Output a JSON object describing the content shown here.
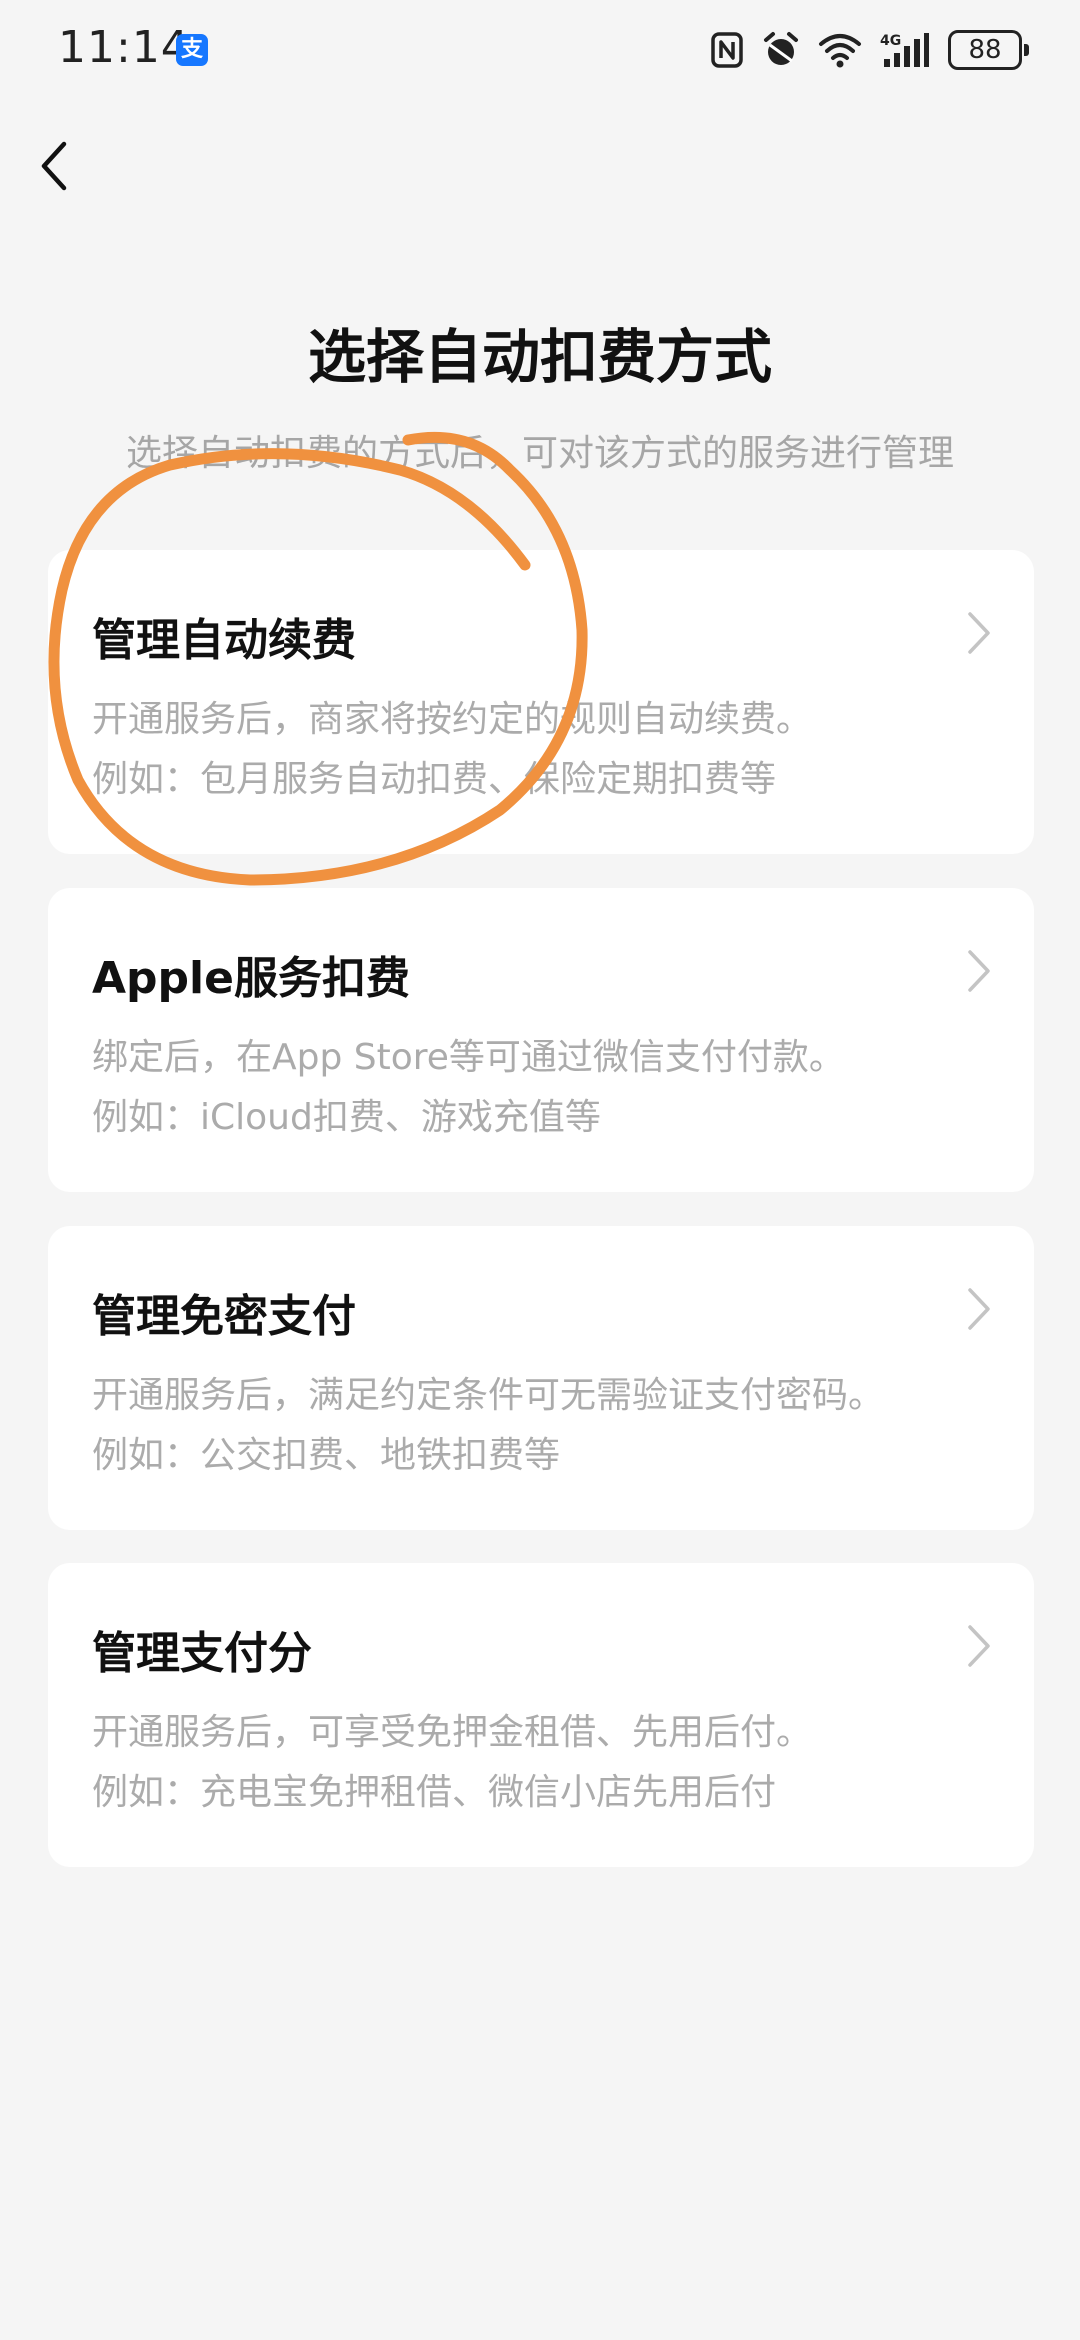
{
  "status_bar": {
    "time": "11:14",
    "app_badge": "支",
    "battery": "88",
    "network": "4G"
  },
  "colors": {
    "background": "#f5f5f5",
    "card": "#ffffff",
    "annotation": "#f0913f",
    "alipay_blue": "#1677ff",
    "muted_text": "#ababab"
  },
  "header": {
    "title": "选择自动扣费方式",
    "subtitle": "选择自动扣费的方式后，可对该方式的服务进行管理"
  },
  "options": [
    {
      "title": "管理自动续费",
      "line1": "开通服务后，商家将按约定的规则自动续费。",
      "line2": "例如：包月服务自动扣费、保险定期扣费等"
    },
    {
      "title": "Apple服务扣费",
      "line1": "绑定后，在App Store等可通过微信支付付款。",
      "line2": "例如：iCloud扣费、游戏充值等"
    },
    {
      "title": "管理免密支付",
      "line1": "开通服务后，满足约定条件可无需验证支付密码。",
      "line2": "例如：公交扣费、地铁扣费等"
    },
    {
      "title": "管理支付分",
      "line1": "开通服务后，可享受免押金租借、先用后付。",
      "line2": "例如：充电宝免押租借、微信小店先用后付"
    }
  ]
}
